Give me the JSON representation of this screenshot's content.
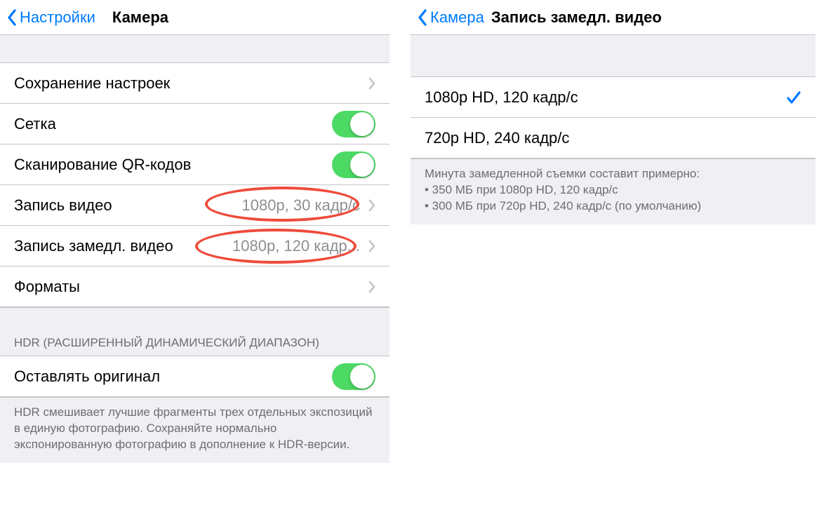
{
  "left": {
    "nav_back": "Настройки",
    "nav_title": "Камера",
    "rows": [
      {
        "label": "Сохранение настроек",
        "type": "disclosure"
      },
      {
        "label": "Сетка",
        "type": "toggle",
        "on": true
      },
      {
        "label": "Сканирование QR-кодов",
        "type": "toggle",
        "on": true
      },
      {
        "label": "Запись видео",
        "value": "1080p, 30 кадр/с",
        "type": "disclosure"
      },
      {
        "label": "Запись замедл. видео",
        "value": "1080p, 120 кадр...",
        "type": "disclosure"
      },
      {
        "label": "Форматы",
        "type": "disclosure"
      }
    ],
    "hdr_header": "HDR (РАСШИРЕННЫЙ ДИНАМИЧЕСКИЙ ДИАПАЗОН)",
    "hdr_toggle_label": "Оставлять оригинал",
    "hdr_footer": "HDR смешивает лучшие фрагменты трех отдельных экспозиций в единую фотографию. Сохраняйте нормально экспонированную фотографию в дополнение к HDR-версии."
  },
  "right": {
    "nav_back": "Камера",
    "nav_title": "Запись замедл. видео",
    "options": [
      {
        "label": "1080p HD, 120 кадр/с",
        "selected": true
      },
      {
        "label": "720p HD, 240 кадр/с",
        "selected": false
      }
    ],
    "footer_lines": [
      "Минута замедленной съемки составит примерно:",
      "• 350 МБ при 1080p HD, 120 кадр/с",
      "• 300 МБ при 720p HD, 240 кадр/с (по умолчанию)"
    ]
  }
}
